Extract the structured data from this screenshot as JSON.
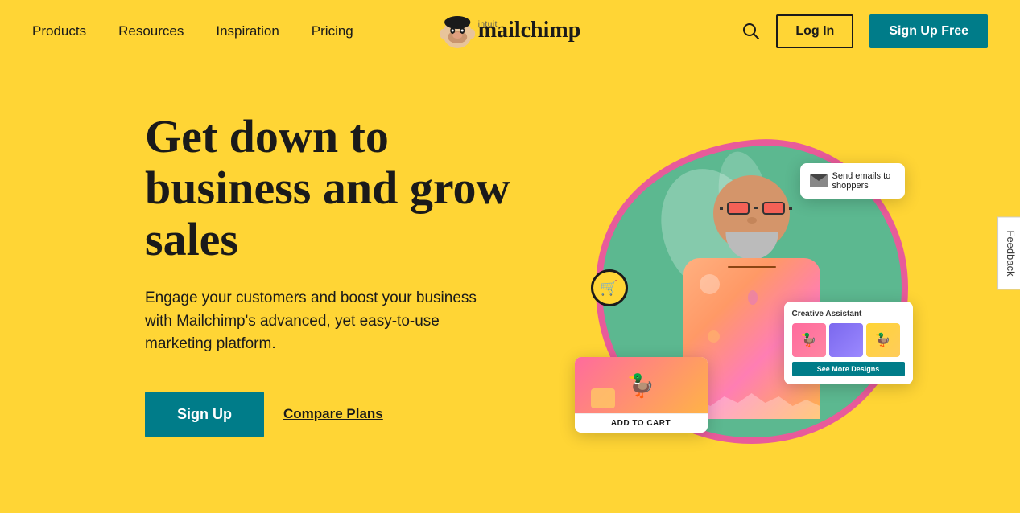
{
  "nav": {
    "items": [
      {
        "label": "Products",
        "id": "products"
      },
      {
        "label": "Resources",
        "id": "resources"
      },
      {
        "label": "Inspiration",
        "id": "inspiration"
      },
      {
        "label": "Pricing",
        "id": "pricing"
      }
    ],
    "logo": {
      "intuit": "intuit",
      "brand": "mailchimp"
    },
    "login_label": "Log In",
    "signup_label": "Sign Up Free"
  },
  "hero": {
    "heading": "Get down to business and grow sales",
    "subtext": "Engage your customers and boost your business with Mailchimp's advanced, yet easy-to-use marketing platform.",
    "cta_primary": "Sign Up",
    "cta_secondary": "Compare Plans"
  },
  "floating_cards": {
    "send_email": {
      "text": "Send emails to shoppers"
    },
    "creative_assistant": {
      "title": "Creative Assistant",
      "btn": "See More Designs"
    },
    "product": {
      "add_to_cart": "ADD TO CART"
    }
  },
  "feedback": {
    "label": "Feedback"
  },
  "colors": {
    "background": "#FFD535",
    "teal": "#007C89",
    "dark": "#1a1a1a",
    "pink": "#E85B9A"
  },
  "icons": {
    "search": "🔍",
    "cart": "🛒",
    "email": "✉",
    "duck": "🦆"
  }
}
